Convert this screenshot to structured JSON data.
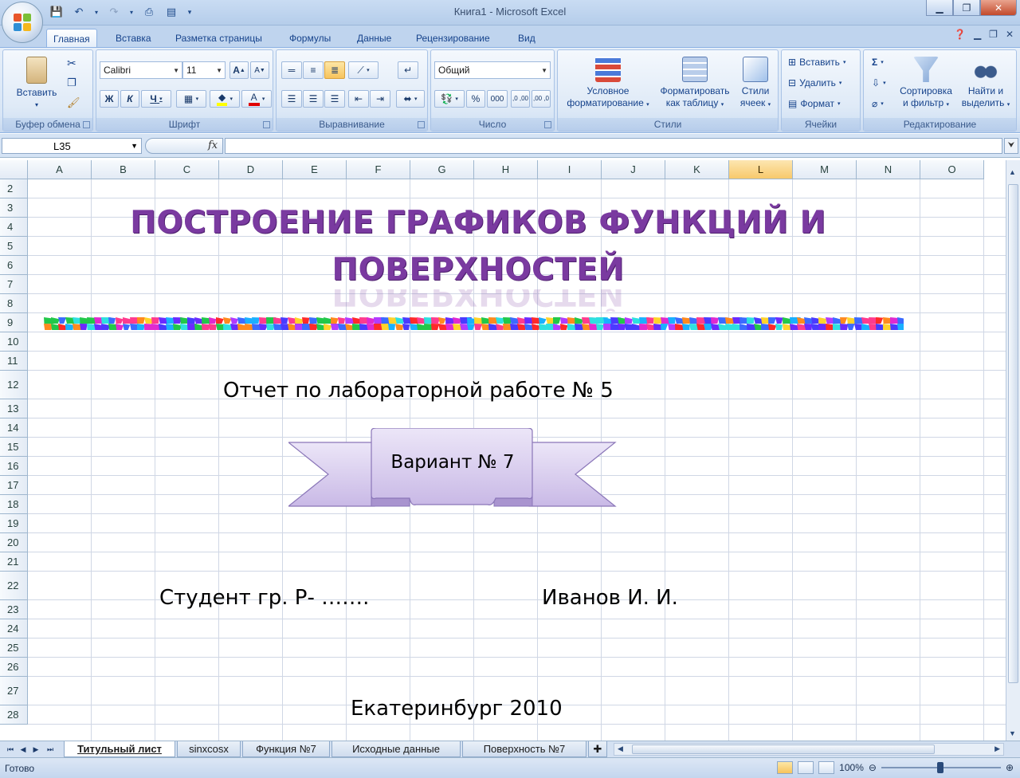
{
  "window": {
    "title": "Книга1 - Microsoft Excel"
  },
  "ribbon_tabs": [
    "Главная",
    "Вставка",
    "Разметка страницы",
    "Формулы",
    "Данные",
    "Рецензирование",
    "Вид"
  ],
  "clipboard": {
    "paste": "Вставить",
    "label": "Буфер обмена"
  },
  "font": {
    "name": "Calibri",
    "size": "11",
    "label": "Шрифт",
    "bold": "Ж",
    "italic": "К",
    "underline": "Ч",
    "grow": "A",
    "shrink": "A",
    "color_glyph": "А"
  },
  "alignment": {
    "label": "Выравнивание"
  },
  "number": {
    "format": "Общий",
    "label": "Число",
    "percent": "%",
    "thousands": "000",
    "inc": ",0 ,00",
    "dec": ",00 ,0"
  },
  "styles": {
    "label": "Стили",
    "conditional": [
      "Условное",
      "форматирование"
    ],
    "as_table": [
      "Форматировать",
      "как таблицу"
    ],
    "cell_styles": [
      "Стили",
      "ячеек"
    ]
  },
  "cells_group": {
    "label": "Ячейки",
    "insert": "Вставить",
    "delete": "Удалить",
    "format": "Формат"
  },
  "editing": {
    "label": "Редактирование",
    "sort": [
      "Сортировка",
      "и фильтр"
    ],
    "find": [
      "Найти и",
      "выделить"
    ],
    "sum": "Σ"
  },
  "formula_bar": {
    "name_box": "L35",
    "fx": "fx",
    "value": ""
  },
  "columns": [
    "A",
    "B",
    "C",
    "D",
    "E",
    "F",
    "G",
    "H",
    "I",
    "J",
    "K",
    "L",
    "M",
    "N",
    "O"
  ],
  "selected_column": "L",
  "rows": [
    "2",
    "3",
    "4",
    "5",
    "6",
    "7",
    "8",
    "9",
    "10",
    "11",
    "12",
    "13",
    "14",
    "15",
    "16",
    "17",
    "18",
    "19",
    "20",
    "21",
    "22",
    "23",
    "24",
    "25",
    "26",
    "27",
    "28"
  ],
  "sheet_content": {
    "title_line1": "ПОСТРОЕНИЕ ГРАФИКОВ ФУНКЦИЙ И",
    "title_line2": "ПОВЕРХНОСТЕЙ",
    "report": "Отчет по лабораторной работе № 5",
    "variant": "Вариант № 7",
    "student": "Студент гр. Р- …….",
    "name": "Иванов И. И.",
    "city_year": "Екатеринбург 2010"
  },
  "sheet_tabs": [
    "Титульный лист",
    "sinxcosx",
    "Функция №7",
    "Исходные данные",
    "Поверхность №7"
  ],
  "active_sheet": "Титульный лист",
  "status": {
    "ready": "Готово",
    "zoom": "100%"
  },
  "colors": {
    "title_purple": "#7a3aa0",
    "ribbon_blue": "#d7e5f6",
    "banner_lilac": "#d8cdef",
    "selected_header": "#f8c96b"
  }
}
